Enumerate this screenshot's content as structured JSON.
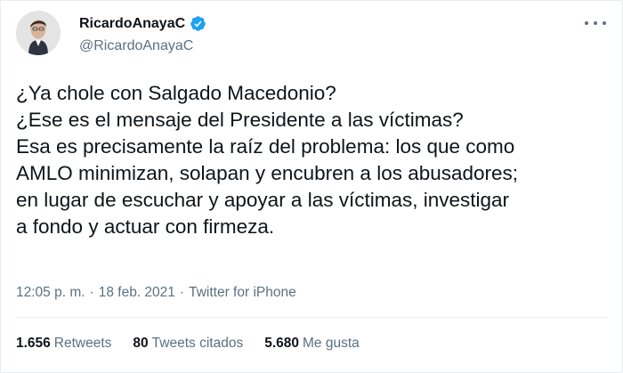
{
  "tweet": {
    "author": {
      "display_name": "RicardoAnayaC",
      "handle": "@RicardoAnayaC",
      "verified": true
    },
    "text_lines": [
      "¿Ya chole con Salgado Macedonio?",
      "¿Ese es el mensaje del Presidente a las víctimas?",
      "Esa es precisamente la raíz del problema: los que como",
      "AMLO minimizan, solapan y encubren a los abusadores;",
      "en lugar de escuchar y apoyar a las víctimas, investigar",
      "a fondo y actuar con firmeza."
    ],
    "time": "12:05 p. m.",
    "separator": "·",
    "date": "18 feb. 2021",
    "source": "Twitter for iPhone"
  },
  "stats": {
    "retweets_count": "1.656",
    "retweets_label": "Retweets",
    "quotes_count": "80",
    "quotes_label": "Tweets citados",
    "likes_count": "5.680",
    "likes_label": "Me gusta"
  },
  "icons": {
    "verified": "verified-badge-icon",
    "more": "more-options-icon"
  },
  "colors": {
    "verified_blue": "#1da1f2",
    "secondary_text": "#5b7083",
    "primary_text": "#0f1419",
    "border": "#e6ecf0"
  }
}
